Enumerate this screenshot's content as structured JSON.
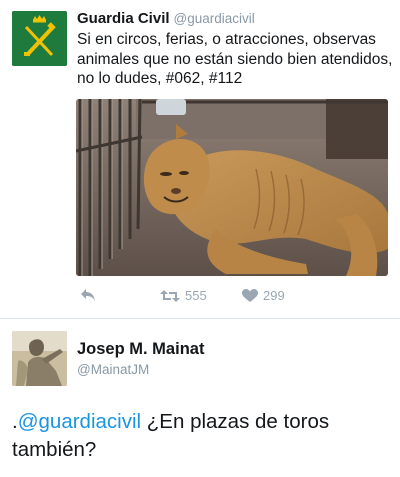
{
  "tweet1": {
    "name": "Guardia Civil",
    "handle": "@guardiacivil",
    "text": "Si en circos, ferias, o atracciones, observas animales que no están siendo bien atendidos, no lo dudes, #062, #112",
    "retweets": "555",
    "likes": "299",
    "icons": [
      "reply-icon",
      "retweet-icon",
      "heart-icon"
    ],
    "avatar_color": "#1f7a3e",
    "emblem_color": "#f2c200"
  },
  "tweet2": {
    "name": "Josep M. Mainat",
    "handle": "@MainatJM",
    "text_prefix": ".",
    "mention": "@guardiacivil",
    "text_rest": " ¿En plazas de toros también?",
    "mention_color": "#1b95e0"
  }
}
